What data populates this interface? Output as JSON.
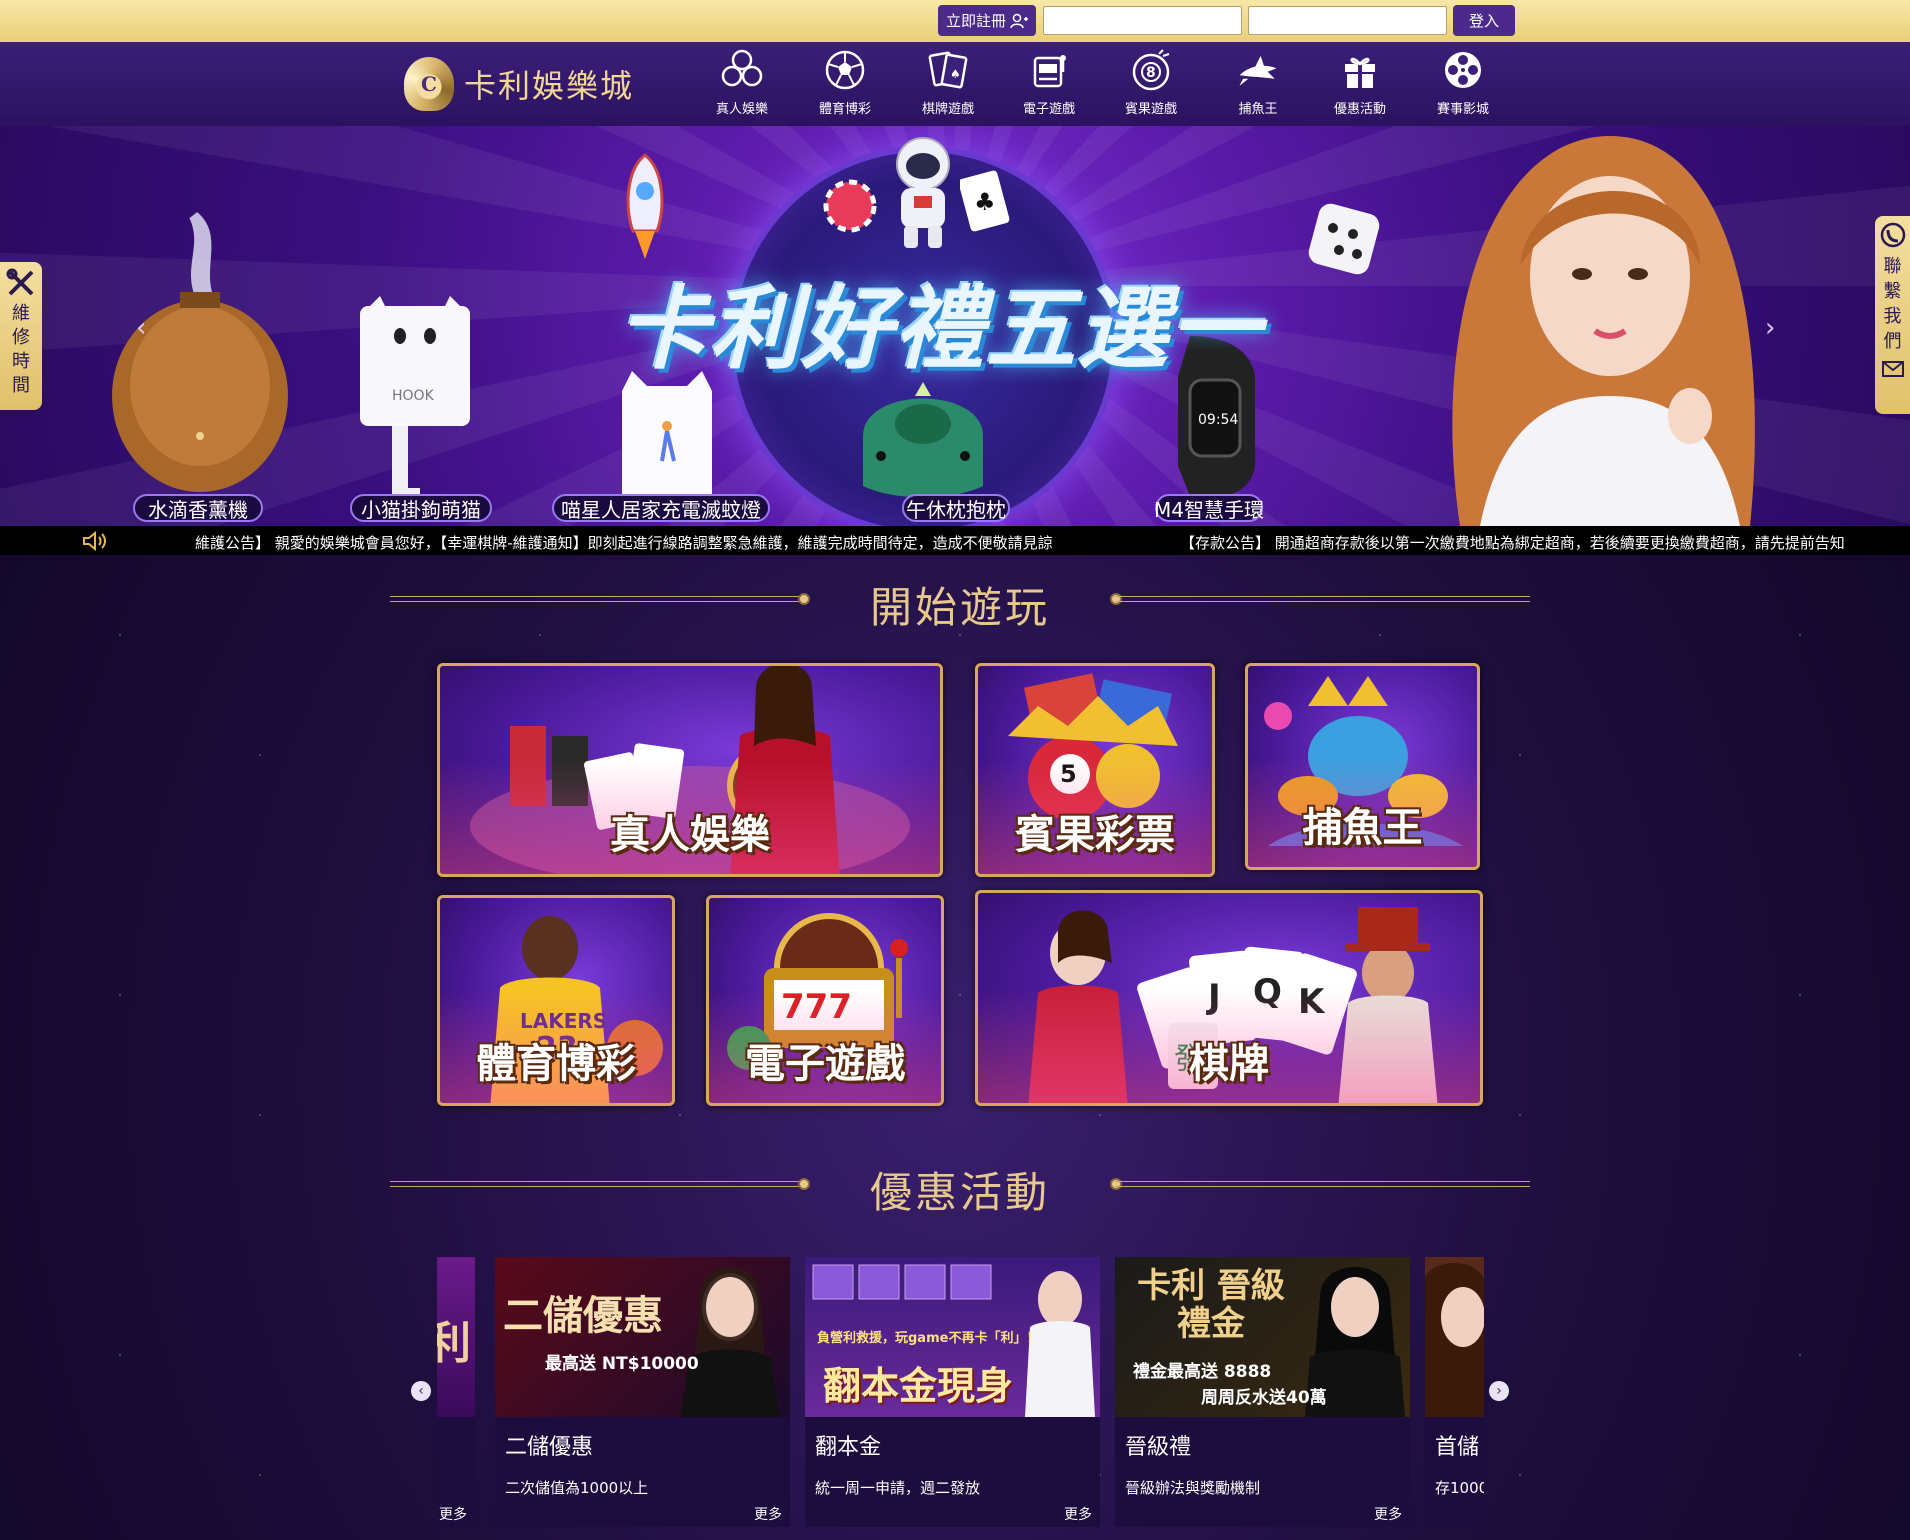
{
  "topbar": {
    "register_label": "立即註冊",
    "account_placeholder": "",
    "password_placeholder": "",
    "login_label": "登入"
  },
  "logo": {
    "mark": "C",
    "text": "卡利娛樂城"
  },
  "nav": [
    {
      "label": "真人娛樂",
      "icon": "chips-icon"
    },
    {
      "label": "體育博彩",
      "icon": "soccer-ball-icon"
    },
    {
      "label": "棋牌遊戲",
      "icon": "playing-cards-icon"
    },
    {
      "label": "電子遊戲",
      "icon": "slot-machine-icon"
    },
    {
      "label": "賓果遊戲",
      "icon": "bingo-ball-icon"
    },
    {
      "label": "捕魚王",
      "icon": "shark-icon"
    },
    {
      "label": "優惠活動",
      "icon": "gift-icon"
    },
    {
      "label": "賽事影城",
      "icon": "film-reel-icon"
    }
  ],
  "banner": {
    "title": "卡利好禮五選一",
    "products": [
      "水滴香薰機",
      "小猫掛鉤萌猫",
      "喵星人居家充電滅蚊燈",
      "午休枕抱枕",
      "M4智慧手環"
    ]
  },
  "side": {
    "maintenance": "維修時間",
    "contact": "聯繫我們"
  },
  "marquee": {
    "notice1": "維護公告】 親愛的娛樂城會員您好，【幸運棋牌-維護通知】即刻起進行線路調整緊急維護，維護完成時間待定，造成不便敬請見諒",
    "notice2": "【存款公告】 開通超商存款後以第一次繳費地點為綁定超商，若後續要更換繳費超商，請先提前告知"
  },
  "sections": {
    "play": "開始遊玩",
    "promos": "優惠活動"
  },
  "games": [
    {
      "label": "真人娛樂"
    },
    {
      "label": "賓果彩票"
    },
    {
      "label": "捕魚王"
    },
    {
      "label": "體育博彩"
    },
    {
      "label": "電子遊戲"
    },
    {
      "label": "棋牌"
    }
  ],
  "promos": [
    {
      "banner_title": "利",
      "title": "",
      "desc": "",
      "more": "更多"
    },
    {
      "banner_title": "二儲優惠",
      "banner_sub": "最高送 NT$10000",
      "title": "二儲優惠",
      "desc": "二次儲值為1000以上",
      "more": "更多"
    },
    {
      "banner_title": "翻本金現身",
      "banner_sub": "負營利救援，玩game不再卡「利」！",
      "title": "翻本金",
      "desc": "統一周一申請，週二發放",
      "more": "更多"
    },
    {
      "banner_title": "卡利 晉級禮金",
      "banner_sub": "禮金最高送 8888",
      "banner_sub2": "周周反水送40萬",
      "title": "晉級禮",
      "desc": "晉級辦法與獎勵機制",
      "more": "更多"
    },
    {
      "banner_title": "",
      "title": "首儲",
      "desc": "存1000",
      "more": ""
    }
  ],
  "colors": {
    "accent_gold": "#e8c98d",
    "nav_purple": "#3b1f78",
    "button_purple": "#4b2a8c",
    "topbar_gold": "#f2dc90"
  }
}
